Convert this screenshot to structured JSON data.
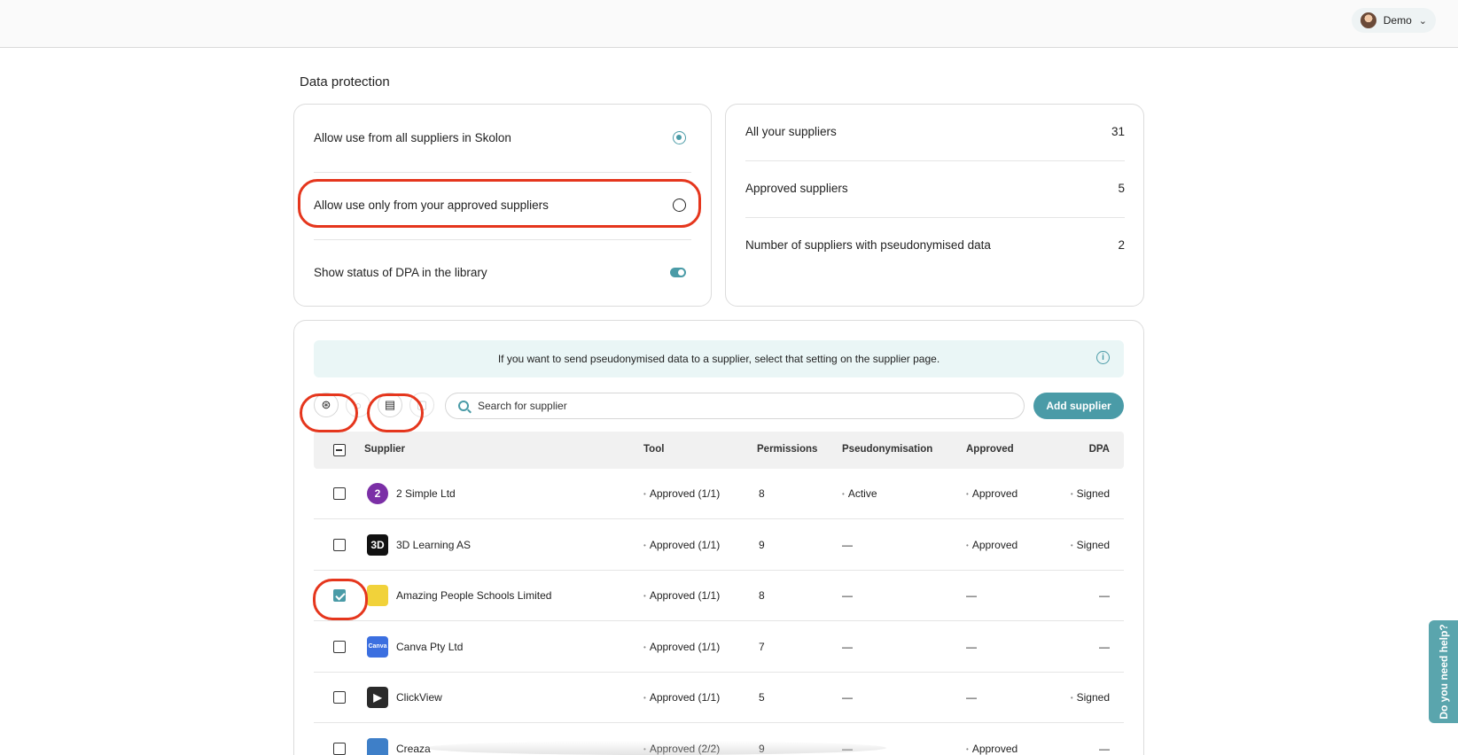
{
  "user": {
    "name": "Demo"
  },
  "page": {
    "title": "Data protection"
  },
  "settings": {
    "all_suppliers_label": "Allow use from all suppliers in Skolon",
    "approved_only_label": "Allow use only from your approved suppliers",
    "dpa_status_label": "Show status of DPA in the library",
    "selected": "all_suppliers",
    "dpa_status_enabled": true
  },
  "stats": {
    "all_label": "All your suppliers",
    "all_value": "31",
    "approved_label": "Approved suppliers",
    "approved_value": "5",
    "pseudo_label": "Number of suppliers with pseudonymised data",
    "pseudo_value": "2"
  },
  "banner": {
    "text": "If you want to send pseudonymised data to a supplier, select that setting on the supplier page."
  },
  "search": {
    "placeholder": "Search for supplier"
  },
  "add_supplier_label": "Add supplier",
  "table": {
    "headers": {
      "supplier": "Supplier",
      "tool": "Tool",
      "permissions": "Permissions",
      "pseudonymisation": "Pseudonymisation",
      "approved": "Approved",
      "dpa": "DPA"
    },
    "rows": [
      {
        "name": "2 Simple Ltd",
        "tool": "Approved (1/1)",
        "permissions": "8",
        "pseudonymisation": "Active",
        "approved": "Approved",
        "dpa": "Signed",
        "checked": false,
        "logo_text": "2",
        "logo_color": "#7b2fa6"
      },
      {
        "name": "3D Learning AS",
        "tool": "Approved (1/1)",
        "permissions": "9",
        "pseudonymisation": "—",
        "approved": "Approved",
        "dpa": "Signed",
        "checked": false,
        "logo_text": "3D",
        "logo_color": "#111111"
      },
      {
        "name": "Amazing People Schools Limited",
        "tool": "Approved (1/1)",
        "permissions": "8",
        "pseudonymisation": "—",
        "approved": "—",
        "dpa": "—",
        "checked": true,
        "logo_text": "",
        "logo_color": "#f1d23a"
      },
      {
        "name": "Canva Pty Ltd",
        "tool": "Approved (1/1)",
        "permissions": "7",
        "pseudonymisation": "—",
        "approved": "—",
        "dpa": "—",
        "checked": false,
        "logo_text": "Canva",
        "logo_color": "#3b6fe0"
      },
      {
        "name": "ClickView",
        "tool": "Approved (1/1)",
        "permissions": "5",
        "pseudonymisation": "—",
        "approved": "—",
        "dpa": "Signed",
        "checked": false,
        "logo_text": "▶",
        "logo_color": "#2a2a2a"
      },
      {
        "name": "Creaza",
        "tool": "Approved (2/2)",
        "permissions": "9",
        "pseudonymisation": "—",
        "approved": "Approved",
        "dpa": "—",
        "checked": false,
        "logo_text": "",
        "logo_color": "#3e7fc8"
      }
    ]
  },
  "help_tab": {
    "label": "Do you need help?"
  },
  "colors": {
    "accent": "#4a9ba7",
    "highlight": "#e5361d",
    "banner_bg": "#eaf6f6"
  }
}
